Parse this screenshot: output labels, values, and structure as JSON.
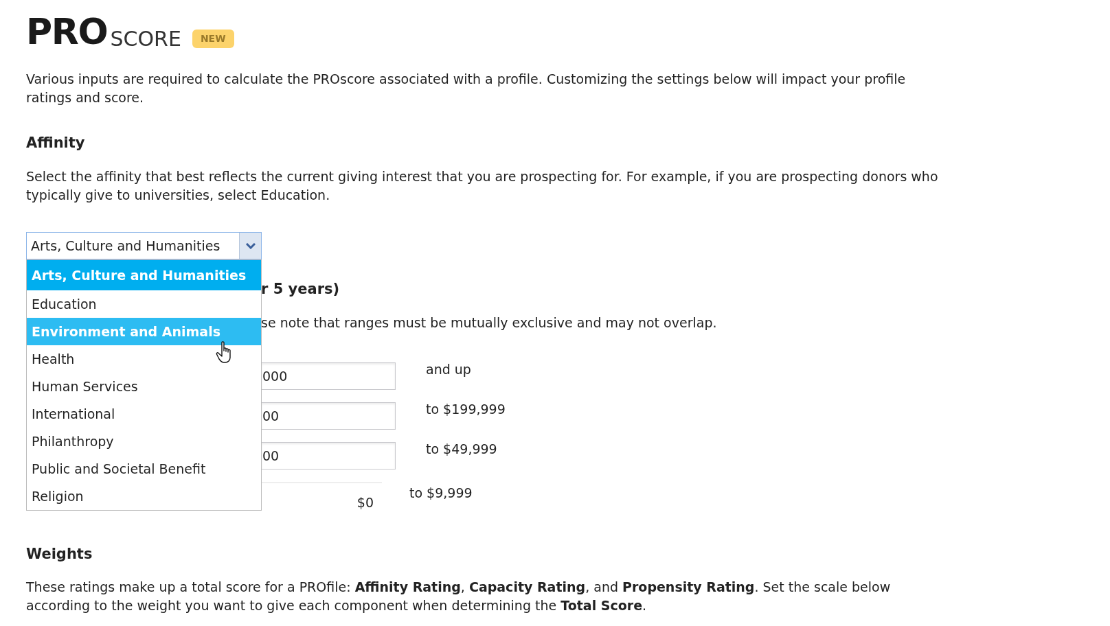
{
  "logo": {
    "bold": "PRO",
    "light": "SCORE",
    "badge": "NEW"
  },
  "intro": "Various inputs are required to calculate the PROscore associated with a profile. Customizing the settings below will impact your profile ratings and score.",
  "affinity": {
    "heading": "Affinity",
    "description": "Select the affinity that best reflects the current giving interest that you are prospecting for. For example, if you are prospecting donors who typically give to universities, select Education.",
    "select": {
      "value": "Arts, Culture and Humanities",
      "expanded": true,
      "options": [
        {
          "label": "Arts, Culture and Humanities",
          "selected": true,
          "hovered": false
        },
        {
          "label": "Education",
          "selected": false,
          "hovered": false
        },
        {
          "label": "Environment and Animals",
          "selected": false,
          "hovered": true
        },
        {
          "label": "Health",
          "selected": false,
          "hovered": false
        },
        {
          "label": "Human Services",
          "selected": false,
          "hovered": false
        },
        {
          "label": "International",
          "selected": false,
          "hovered": false
        },
        {
          "label": "Philanthropy",
          "selected": false,
          "hovered": false
        },
        {
          "label": "Public and Societal Benefit",
          "selected": false,
          "hovered": false
        },
        {
          "label": "Religion",
          "selected": false,
          "hovered": false
        }
      ]
    }
  },
  "capacity": {
    "heading": "r 5 years)",
    "note": "se note that ranges must be mutually exclusive and may not overlap.",
    "ranges": [
      {
        "kind": "input",
        "value": "000",
        "label": "and up"
      },
      {
        "kind": "input",
        "value": "00",
        "label": "to $199,999"
      },
      {
        "kind": "input",
        "value": "00",
        "label": "to $49,999"
      },
      {
        "kind": "fixed",
        "value": "$0",
        "label": "to $9,999"
      }
    ]
  },
  "weights": {
    "heading": "Weights",
    "description": "These ratings make up a total score for a PROfile: **Affinity Rating**, **Capacity Rating**, and **Propensity Rating**. Set the scale below according to the weight you want to give each component when determining the **Total Score**."
  }
}
